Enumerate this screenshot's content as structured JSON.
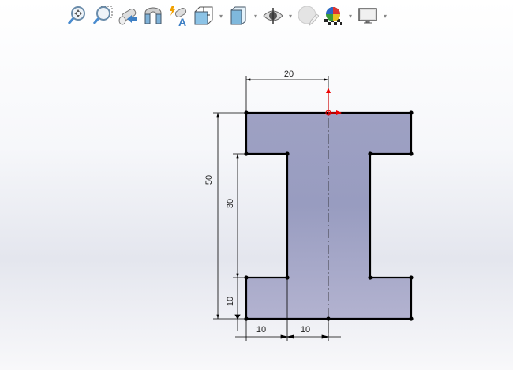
{
  "toolbar": {
    "items": [
      {
        "name": "zoom-to-fit",
        "icon": "zoom-to-fit-icon"
      },
      {
        "name": "zoom-to-area",
        "icon": "zoom-to-area-icon"
      },
      {
        "name": "previous-view",
        "icon": "previous-view-icon"
      },
      {
        "name": "section-view",
        "icon": "section-view-icon"
      },
      {
        "name": "dynamic-annotation-views",
        "icon": "dynamic-annotation-icon"
      },
      {
        "name": "view-orientation",
        "icon": "view-orientation-icon",
        "dropdown": true
      },
      {
        "name": "display-style",
        "icon": "display-style-icon",
        "dropdown": true
      },
      {
        "name": "hide-show-items",
        "icon": "eye-icon",
        "dropdown": true
      },
      {
        "name": "edit-appearance",
        "icon": "edit-appearance-icon"
      },
      {
        "name": "apply-scene",
        "icon": "scene-icon",
        "dropdown": true
      },
      {
        "name": "view-settings",
        "icon": "monitor-icon",
        "dropdown": true
      }
    ],
    "dropdown_glyph": "▾"
  },
  "sketch": {
    "fill_color": "#a0a3c4",
    "dimensions": {
      "top_width": "20",
      "total_height": "50",
      "web_height": "30",
      "flange_thickness": "10",
      "flange_overhang": "10",
      "half_web_width": "10"
    }
  }
}
